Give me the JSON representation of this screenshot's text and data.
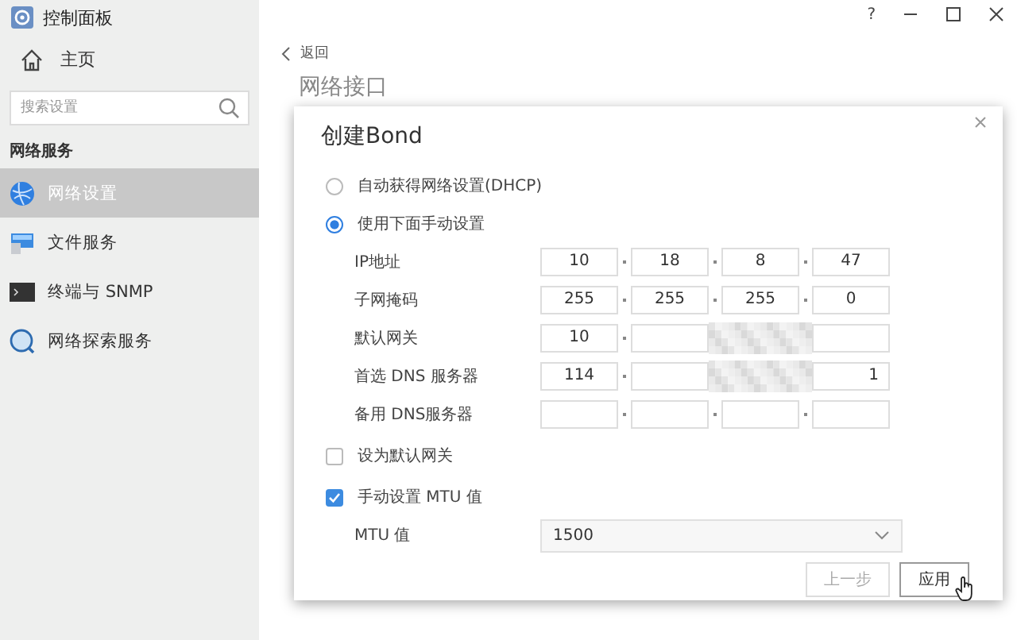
{
  "app": {
    "title": "控制面板"
  },
  "window_controls": [
    {
      "kind": "help",
      "label": "?"
    },
    {
      "kind": "minimize"
    },
    {
      "kind": "maximize"
    },
    {
      "kind": "close"
    }
  ],
  "sidebar": {
    "home": "主页",
    "search": {
      "placeholder": "搜索设置"
    },
    "section": "网络服务",
    "items": [
      {
        "label": "网络设置",
        "kind": "network",
        "selected": true
      },
      {
        "label": "文件服务",
        "kind": "files",
        "selected": false
      },
      {
        "label": "终端与 SNMP",
        "kind": "terminal",
        "selected": false
      },
      {
        "label": "网络探索服务",
        "kind": "discovery",
        "selected": false
      }
    ]
  },
  "page": {
    "back": "返回",
    "title": "网络接口"
  },
  "dialog": {
    "title": "创建Bond",
    "options": [
      {
        "label": "自动获得网络设置(DHCP)",
        "selected": false
      },
      {
        "label": "使用下面手动设置",
        "selected": true
      }
    ],
    "fields": [
      {
        "label": "IP地址",
        "octets": [
          "10",
          "18",
          "8",
          "47"
        ],
        "masked": false
      },
      {
        "label": "子网掩码",
        "octets": [
          "255",
          "255",
          "255",
          "0"
        ],
        "masked": false
      },
      {
        "label": "默认网关",
        "octets": [
          "10"
        ],
        "masked": true
      },
      {
        "label": "首选 DNS 服务器",
        "octets": [
          "114"
        ],
        "last_octet": "1",
        "masked": true
      },
      {
        "label": "备用 DNS服务器",
        "masked": false
      }
    ],
    "checkboxes": [
      {
        "label": "设为默认网关",
        "checked": false
      },
      {
        "label": "手动设置 MTU 值",
        "checked": true
      }
    ],
    "mtu": {
      "label": "MTU 值",
      "value": "1500"
    },
    "buttons": [
      {
        "label": "上一步",
        "kind": "secondary"
      },
      {
        "label": "应用",
        "kind": "primary"
      }
    ]
  }
}
